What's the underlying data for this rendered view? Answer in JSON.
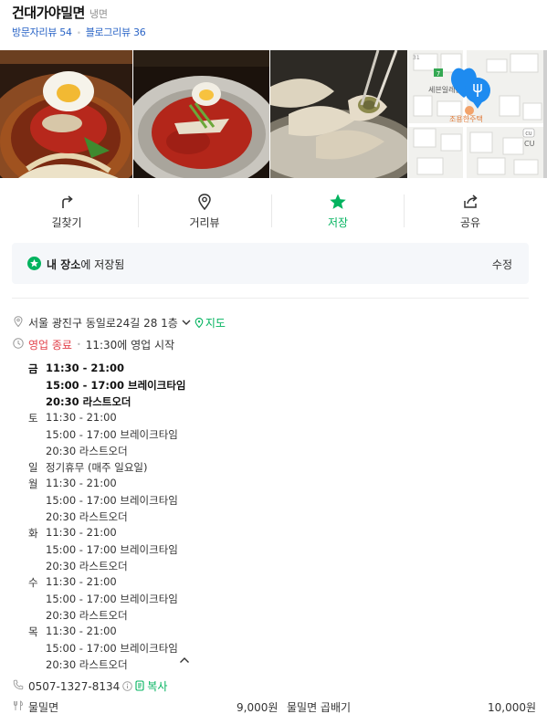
{
  "place": {
    "name": "건대가야밀면",
    "category": "냉면",
    "visitor_reviews": "방문자리뷰 54",
    "blog_reviews": "블로그리뷰 36"
  },
  "map": {
    "label_store": "세븐일레븐",
    "label_house": "조용한주택",
    "label_cu": "CU",
    "label_cu_badge": "CU"
  },
  "actions": [
    {
      "label": "길찾기",
      "icon": "directions-icon"
    },
    {
      "label": "거리뷰",
      "icon": "street-view-icon"
    },
    {
      "label": "저장",
      "icon": "star-icon"
    },
    {
      "label": "공유",
      "icon": "share-icon"
    }
  ],
  "saved": {
    "bold": "내 장소",
    "rest": "에 저장됨",
    "edit": "수정"
  },
  "address": {
    "text": "서울 광진구 동일로24길 28 1층",
    "map_link": "지도"
  },
  "status": {
    "state": "영업 종료",
    "next": "11:30에 영업 시작"
  },
  "hours": [
    {
      "day": "금",
      "lines": [
        "11:30 - 21:00",
        "15:00 - 17:00 브레이크타임",
        "20:30 라스트오더"
      ],
      "today": true
    },
    {
      "day": "토",
      "lines": [
        "11:30 - 21:00",
        "15:00 - 17:00 브레이크타임",
        "20:30 라스트오더"
      ]
    },
    {
      "day": "일",
      "lines": [
        "정기휴무 (매주 일요일)"
      ]
    },
    {
      "day": "월",
      "lines": [
        "11:30 - 21:00",
        "15:00 - 17:00 브레이크타임",
        "20:30 라스트오더"
      ]
    },
    {
      "day": "화",
      "lines": [
        "11:30 - 21:00",
        "15:00 - 17:00 브레이크타임",
        "20:30 라스트오더"
      ]
    },
    {
      "day": "수",
      "lines": [
        "11:30 - 21:00",
        "15:00 - 17:00 브레이크타임",
        "20:30 라스트오더"
      ]
    },
    {
      "day": "목",
      "lines": [
        "11:30 - 21:00",
        "15:00 - 17:00 브레이크타임",
        "20:30 라스트오더"
      ]
    }
  ],
  "phone": {
    "number": "0507-1327-8134",
    "copy": "복사"
  },
  "menu": [
    {
      "name": "물밀면",
      "price": "9,000원"
    },
    {
      "name": "물밀면 곱배기",
      "price": "10,000원"
    }
  ],
  "colors": {
    "accent_green": "#03b35f",
    "link_blue": "#2a64c6",
    "closed_red": "#e2424b"
  }
}
